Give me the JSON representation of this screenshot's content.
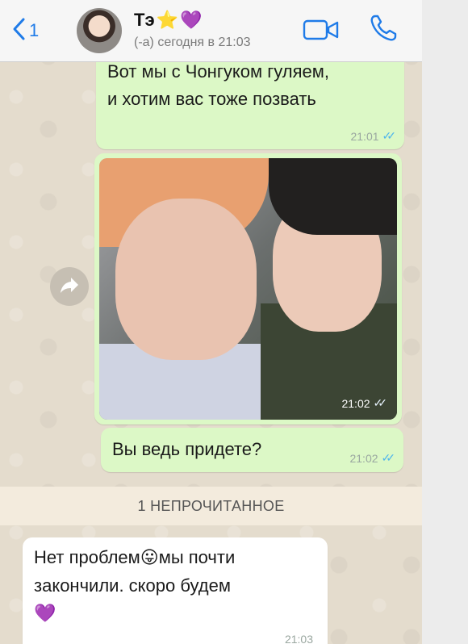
{
  "header": {
    "back_count": "1",
    "contact_name": "Тэ",
    "name_emoji_star": "⭐",
    "name_emoji_heart": "💜",
    "status": "​(-а) сегодня в 21:03"
  },
  "messages": [
    {
      "direction": "out",
      "lines": [
        "Вот мы с Чонгуком гуляем,",
        "и хотим вас тоже позвать"
      ],
      "time": "21:01",
      "ticks": "✓✓"
    },
    {
      "direction": "out",
      "type": "photo",
      "time": "21:02",
      "ticks": "✓✓"
    },
    {
      "direction": "out",
      "lines": [
        "Вы ведь придете?"
      ],
      "time": "21:02",
      "ticks": "✓✓"
    }
  ],
  "unread_label": "1 НЕПРОЧИТАННОЕ",
  "incoming": {
    "direction": "in",
    "line1_before": "Нет проблем",
    "line1_emoji": "😛",
    "line1_after": "мы почти",
    "line2": "закончили. скоро будем",
    "line3_emoji": "💜",
    "time": "21:03"
  },
  "colors": {
    "accent": "#1f7be8",
    "outgoing_bubble": "#dcf8c6",
    "incoming_bubble": "#ffffff",
    "read_ticks": "#4fb6ec"
  },
  "icons": [
    "back-chevron-icon",
    "video-call-icon",
    "phone-icon",
    "forward-arrow-icon"
  ]
}
